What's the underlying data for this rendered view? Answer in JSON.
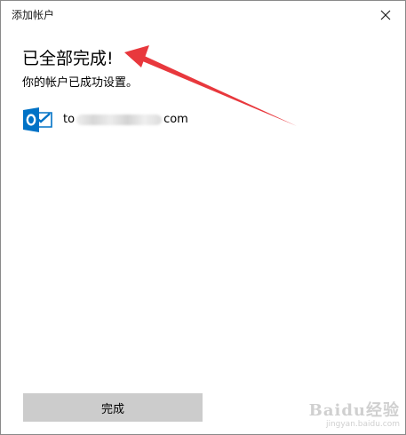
{
  "window": {
    "title": "添加帐户"
  },
  "content": {
    "heading": "已全部完成!",
    "subtext": "你的帐户已成功设置。",
    "account": {
      "email_prefix": "to",
      "email_suffix": "com",
      "icon": "outlook-icon"
    }
  },
  "footer": {
    "done_label": "完成"
  },
  "watermark": {
    "logo": "Baidu经验",
    "url": "jingyan.baidu.com"
  },
  "colors": {
    "outlook_blue": "#0072c6",
    "button_gray": "#cccccc",
    "annotation_red": "#e8383d"
  }
}
